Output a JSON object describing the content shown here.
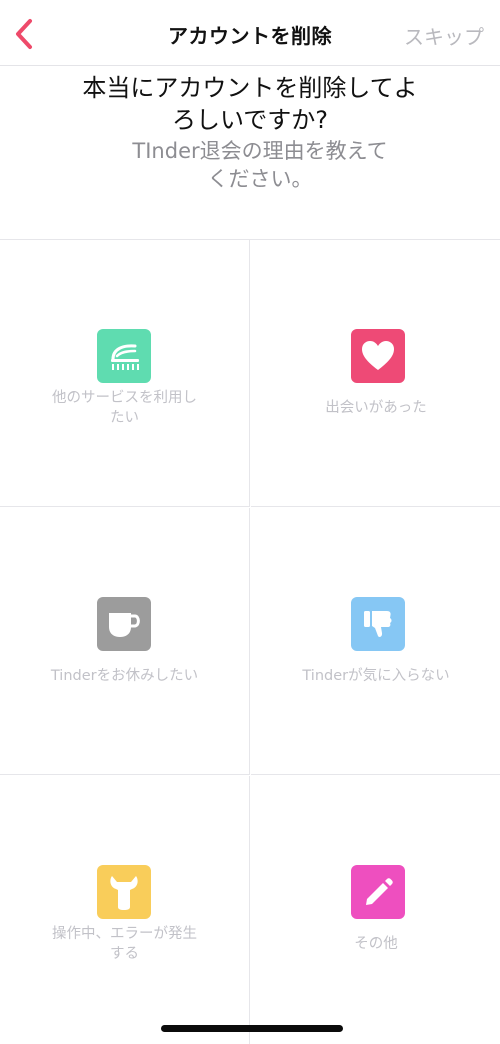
{
  "header": {
    "title": "アカウントを削除",
    "skip_label": "スキップ"
  },
  "prompt": {
    "question_line1": "本当にアカウントを削除してよ",
    "question_line2": "ろしいですか?",
    "subtitle_line1": "TInder退会の理由を教えて",
    "subtitle_line2": "ください。"
  },
  "reasons": [
    {
      "line1": "他のサービスを利用し",
      "line2": "たい",
      "icon": "shower-icon",
      "color": "#5fdcb0"
    },
    {
      "line1": "出会いがあった",
      "line2": "",
      "icon": "heart-icon",
      "color": "#ee4a76"
    },
    {
      "line1": "Tinderをお休みしたい",
      "line2": "",
      "icon": "coffee-cup-icon",
      "color": "#9c9c9c"
    },
    {
      "line1": "Tinderが気に入らない",
      "line2": "",
      "icon": "thumbs-down-icon",
      "color": "#86c7f4"
    },
    {
      "line1": "操作中、エラーが発生",
      "line2": "する",
      "icon": "wrench-icon",
      "color": "#f9cd5a"
    },
    {
      "line1": "その他",
      "line2": "",
      "icon": "pencil-icon",
      "color": "#ee4fbf"
    }
  ],
  "colors": {
    "accent": "#ee4a6a",
    "text_primary": "#111111",
    "text_secondary": "#8d8d92",
    "label": "#c2c2c8"
  }
}
